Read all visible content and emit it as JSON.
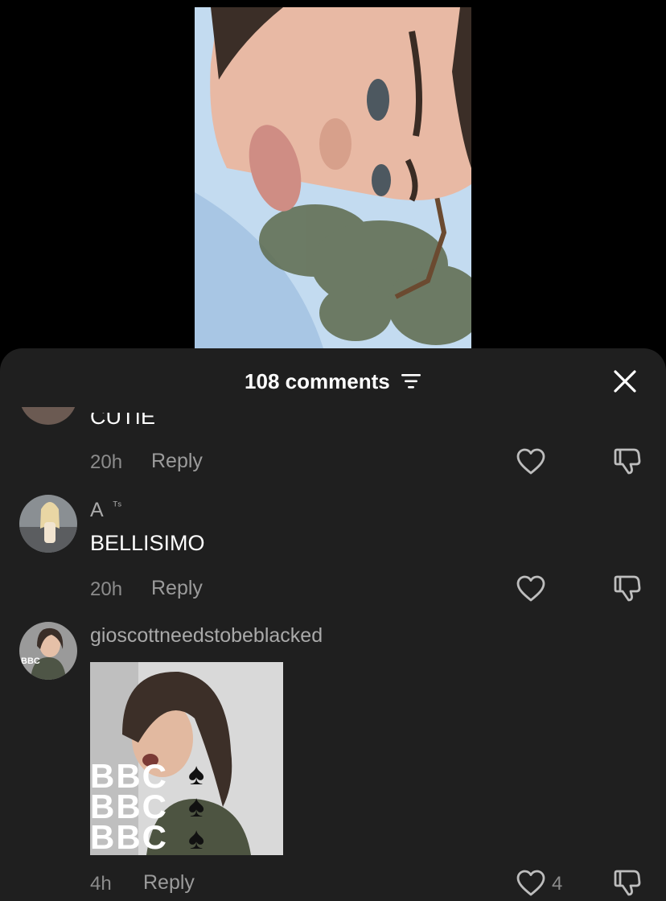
{
  "sheet": {
    "title": "108 comments",
    "background": "#1f1f1f"
  },
  "comments": [
    {
      "text": "CUTIE",
      "time": "20h",
      "reply_label": "Reply"
    },
    {
      "username": "A",
      "username_badge": "ᵀˢ",
      "text": "BELLISIMO",
      "time": "20h",
      "reply_label": "Reply"
    },
    {
      "username": "gioscottneedstobeblacked",
      "time": "4h",
      "reply_label": "Reply",
      "likes": "4",
      "image_overlay_lines": [
        "BBC",
        "BBC",
        "BBC"
      ]
    }
  ],
  "icons": [
    "sort-icon",
    "close-icon",
    "heart-icon",
    "dislike-icon"
  ]
}
